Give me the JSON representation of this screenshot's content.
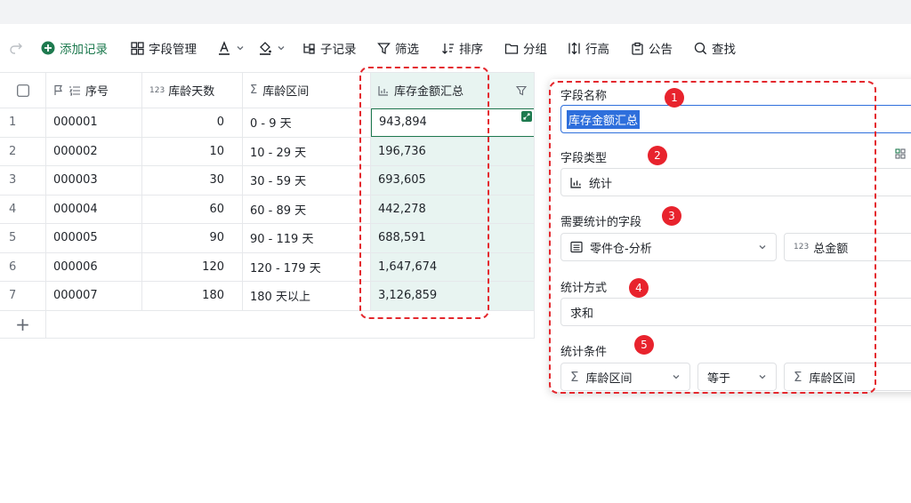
{
  "toolbar": {
    "add_record": "添加记录",
    "field_manage": "字段管理",
    "sub_record": "子记录",
    "filter": "筛选",
    "sort": "排序",
    "group": "分组",
    "row_height": "行高",
    "notice": "公告",
    "find": "查找"
  },
  "table": {
    "headers": [
      "序号",
      "库龄天数",
      "库龄区间",
      "库存金额汇总"
    ],
    "header_prefix_num": "123",
    "rows": [
      {
        "idx": "1",
        "seq": "000001",
        "days": "0",
        "range": "0 - 9 天",
        "amount": "943,894"
      },
      {
        "idx": "2",
        "seq": "000002",
        "days": "10",
        "range": "10 - 29 天",
        "amount": "196,736"
      },
      {
        "idx": "3",
        "seq": "000003",
        "days": "30",
        "range": "30 - 59 天",
        "amount": "693,605"
      },
      {
        "idx": "4",
        "seq": "000004",
        "days": "60",
        "range": "60 - 89 天",
        "amount": "442,278"
      },
      {
        "idx": "5",
        "seq": "000005",
        "days": "90",
        "range": "90 - 119 天",
        "amount": "688,591"
      },
      {
        "idx": "6",
        "seq": "000006",
        "days": "120",
        "range": "120 - 179 天",
        "amount": "1,647,674"
      },
      {
        "idx": "7",
        "seq": "000007",
        "days": "180",
        "range": "180 天以上",
        "amount": "3,126,859"
      }
    ]
  },
  "panel": {
    "field_name_label": "字段名称",
    "field_name_value": "库存金额汇总",
    "field_type_label": "字段类型",
    "field_type_value": "统计",
    "stat_field_label": "需要统计的字段",
    "stat_table": "零件仓-分析",
    "stat_field_prefix": "123",
    "stat_field": "总金额",
    "method_label": "统计方式",
    "method_value": "求和",
    "cond_label": "统计条件",
    "cond_field": "库龄区间",
    "cond_op": "等于",
    "cond_target": "库龄区间",
    "badges": [
      "1",
      "2",
      "3",
      "4",
      "5"
    ]
  },
  "colors": {
    "accent_green": "#1e7a4f",
    "highlight_column": "#e8f4f1",
    "annotation_red": "#e4282e",
    "selection_blue": "#2e6fdc"
  }
}
